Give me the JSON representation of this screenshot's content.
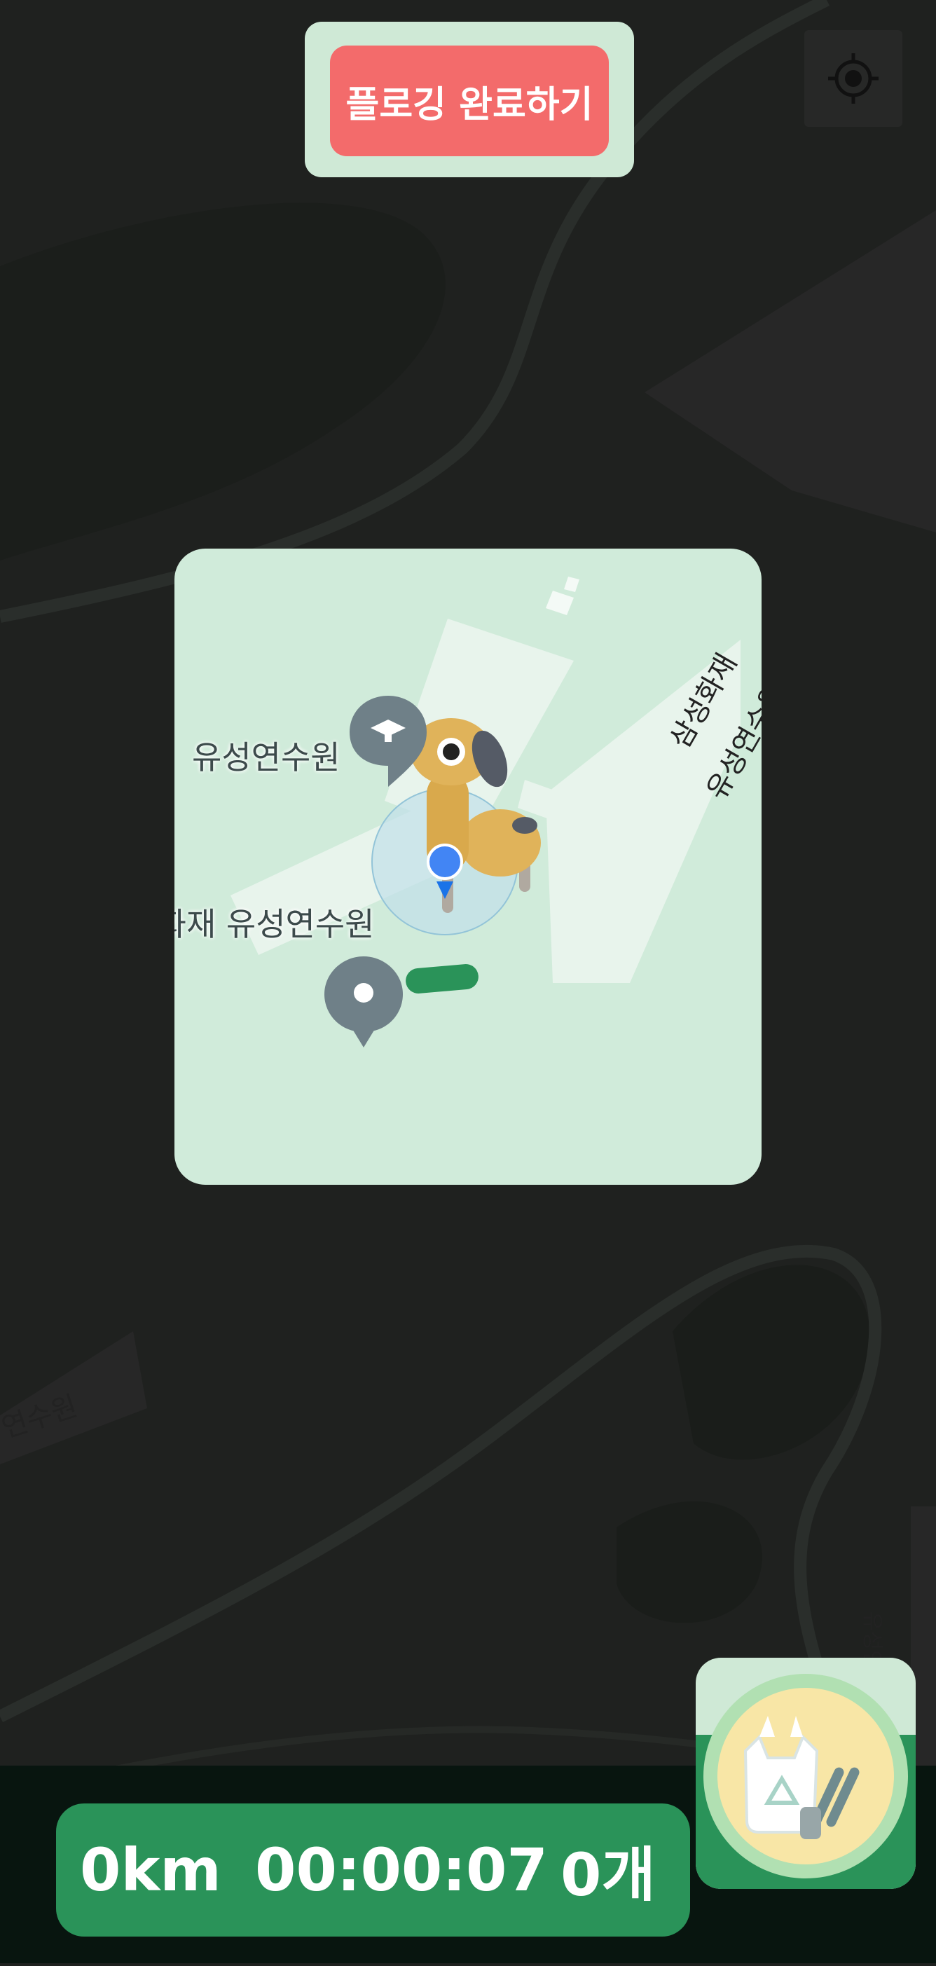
{
  "header": {
    "finish_button_label": "플로깅 완료하기"
  },
  "map": {
    "labels": {
      "background_left": "연수원",
      "background_right": "유성연수원"
    }
  },
  "mini_map": {
    "place_label_1": "유성연수원",
    "place_label_2": "삼성화재 유성연수원",
    "rotated_label_line1": "삼성화재",
    "rotated_label_line2": "유성연수원"
  },
  "stats": {
    "distance": "0km",
    "time": "00:00:07",
    "count": "0개"
  },
  "icons": {
    "locate": "crosshair-icon",
    "trash": "trash-bag-icon",
    "school_pin": "school-pin-icon",
    "place_pin": "place-pin-icon",
    "dog": "dog-character-icon"
  },
  "colors": {
    "finish_button": "#f36b6b",
    "stats_bar": "#2a9359",
    "mini_map_bg": "#d0ebda",
    "location_dot": "#4285f4"
  }
}
